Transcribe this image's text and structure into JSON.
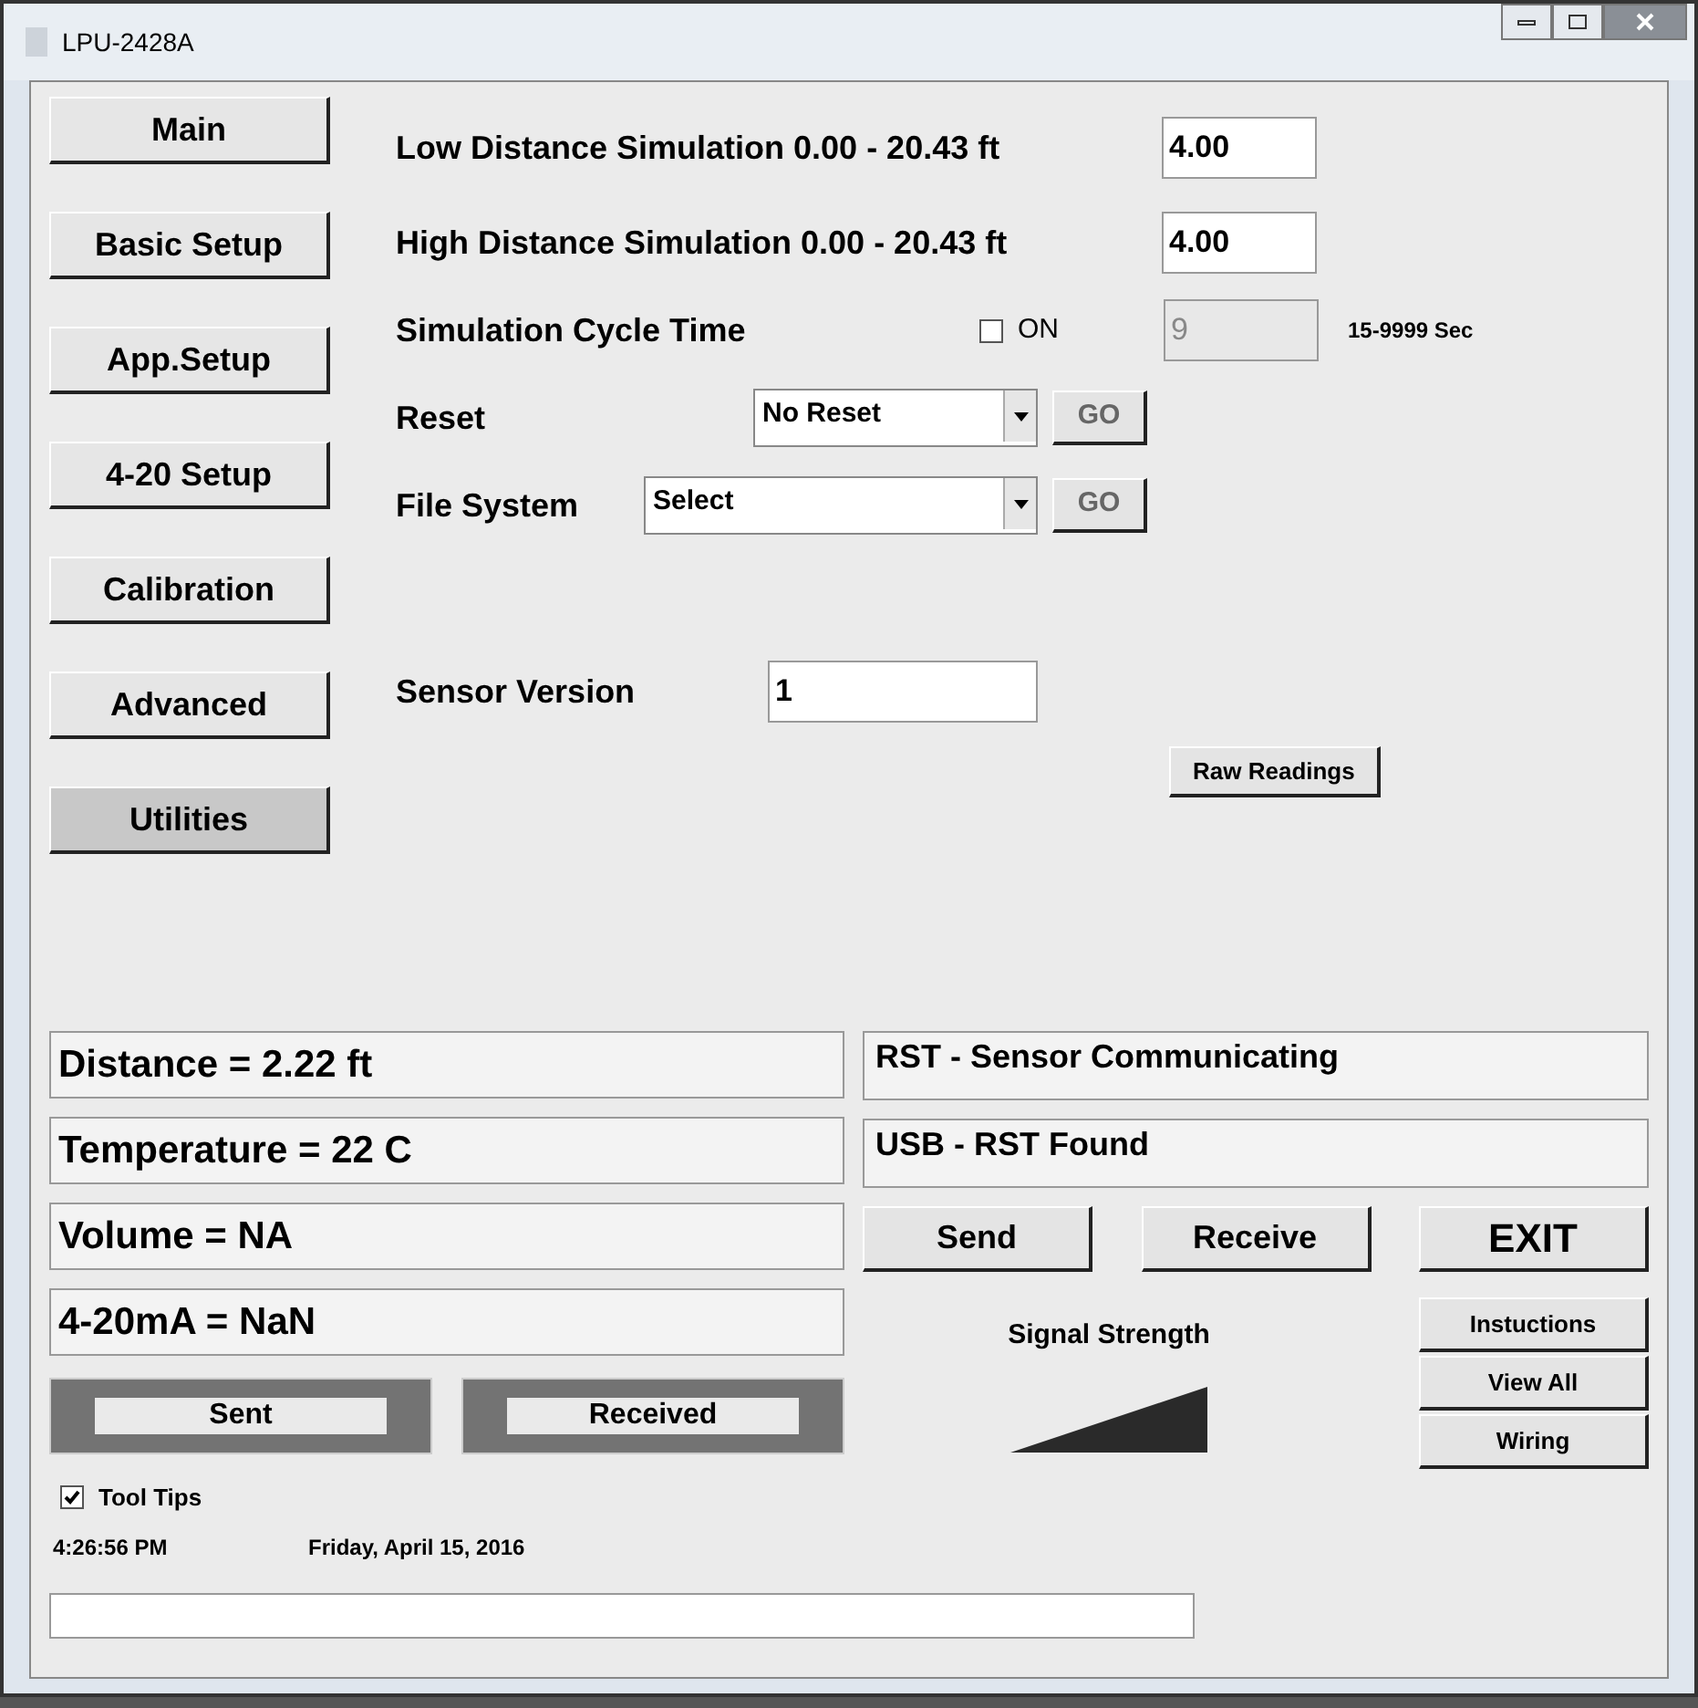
{
  "window": {
    "title": "LPU-2428A"
  },
  "nav": [
    {
      "label": "Main",
      "selected": false
    },
    {
      "label": "Basic Setup",
      "selected": false
    },
    {
      "label": "App.Setup",
      "selected": false
    },
    {
      "label": "4-20 Setup",
      "selected": false
    },
    {
      "label": "Calibration",
      "selected": false
    },
    {
      "label": "Advanced",
      "selected": false
    },
    {
      "label": "Utilities",
      "selected": true
    }
  ],
  "low_distance": {
    "label": "Low Distance Simulation 0.00 - 20.43 ft",
    "value": "4.00"
  },
  "high_distance": {
    "label": "High Distance Simulation 0.00 - 20.43 ft",
    "value": "4.00"
  },
  "cycle": {
    "label": "Simulation Cycle Time",
    "checkbox_label": "ON",
    "checked": false,
    "value": "9",
    "disabled": true,
    "range": "15-9999 Sec"
  },
  "reset": {
    "label": "Reset",
    "value": "No Reset",
    "go": "GO"
  },
  "file_system": {
    "label": "File System",
    "value": "Select",
    "go": "GO"
  },
  "sensor_version": {
    "label": "Sensor Version",
    "value": "1"
  },
  "raw_readings": "Raw Readings",
  "readouts": [
    "Distance = 2.22 ft",
    "Temperature = 22 C",
    "Volume = NA",
    "4-20mA = NaN"
  ],
  "status": [
    "RST - Sensor Communicating",
    "USB - RST Found"
  ],
  "actions": [
    "Send",
    "Receive",
    "EXIT"
  ],
  "indicators": [
    "Sent",
    "Received"
  ],
  "tool_tips": {
    "label": "Tool Tips",
    "checked": true
  },
  "time": "4:26:56 PM",
  "date": "Friday, April 15, 2016",
  "signal_label": "Signal Strength",
  "side_buttons": [
    "Instuctions",
    "View All",
    "Wiring"
  ]
}
